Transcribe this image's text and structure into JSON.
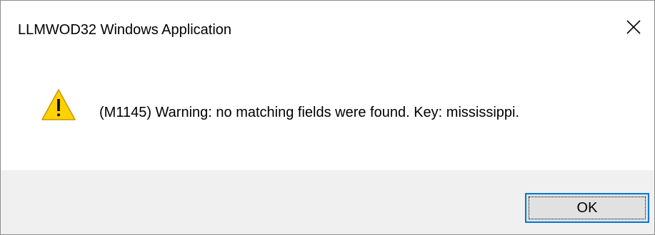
{
  "window": {
    "title": "LLMWOD32 Windows Application"
  },
  "titlebar": {
    "close_icon": "close-icon"
  },
  "content": {
    "icon": "warning-icon",
    "message": "(M1145) Warning: no matching fields were found. Key: mississippi."
  },
  "footer": {
    "ok_label": "OK"
  },
  "colors": {
    "warning_fill": "#ffd200",
    "warning_border": "#c89600",
    "focus_accent": "#0078d7",
    "footer_bg": "#f0f0f0",
    "button_bg": "#e1e1e1"
  }
}
